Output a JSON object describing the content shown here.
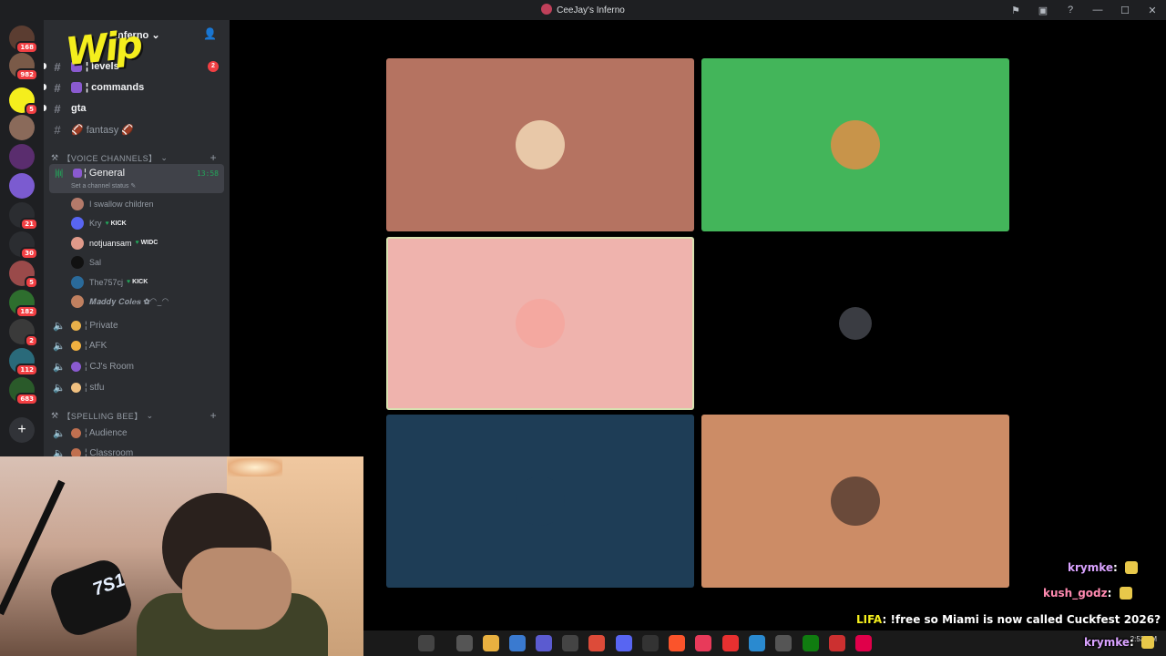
{
  "window": {
    "title": "CeeJay's Inferno"
  },
  "overlay_logo": "Wip",
  "rail": {
    "servers": [
      {
        "badge": "168",
        "color": "#5b3d31"
      },
      {
        "badge": "982",
        "color": "#7a5a48"
      },
      {
        "badge": "5",
        "color": "#f4ee1d"
      },
      {
        "badge": "",
        "color": "#8a6a5a"
      },
      {
        "badge": "",
        "color": "#5a2d6e"
      },
      {
        "badge": "",
        "color": "#7b5bd0"
      },
      {
        "badge": "21",
        "color": "#2b2d31"
      },
      {
        "badge": "30",
        "color": "#2b2d31"
      },
      {
        "badge": "5",
        "color": "#9a4a4a"
      },
      {
        "badge": "182",
        "color": "#2e6e2e"
      },
      {
        "badge": "2",
        "color": "#3a3a3a"
      },
      {
        "badge": "112",
        "color": "#2a6a7a"
      },
      {
        "badge": "683",
        "color": "#2a5a2a"
      }
    ],
    "add_server": "+"
  },
  "sidebar": {
    "server_name": "Inferno",
    "text_channels": [
      {
        "name": "¦ levels",
        "mention": "2",
        "bright": true
      },
      {
        "name": "¦ commands",
        "bright": true
      },
      {
        "name": "gta",
        "bright": true
      },
      {
        "name": "🏈 fantasy 🏈",
        "bright": false
      }
    ],
    "voice_category": "【VOICE CHANNELS】",
    "active_voice": {
      "name": "¦ General",
      "time": "13:58",
      "status": "Set a channel status ✎"
    },
    "members": [
      {
        "name": "I swallow children",
        "tag": "",
        "bright": false,
        "avatar": "#b47a6a"
      },
      {
        "name": "Kry",
        "tag": "KICK",
        "bright": false,
        "avatar": "#5865f2"
      },
      {
        "name": "notjuansam",
        "tag": "WIDC",
        "bright": true,
        "avatar": "#e09a8a"
      },
      {
        "name": "Sal",
        "tag": "",
        "bright": false,
        "avatar": "#111111"
      },
      {
        "name": "The757cj",
        "tag": "KICK",
        "bright": false,
        "avatar": "#2a6a9a"
      },
      {
        "name": "𝑴𝒂𝒅𝒅𝒚 𝑪𝒐𝒍𝒆𝒔 ✿◠‿◠",
        "tag": "",
        "bright": false,
        "avatar": "#c08060"
      }
    ],
    "voice_channels": [
      {
        "name": "¦ Private",
        "emoji": "#e8b04a"
      },
      {
        "name": "¦ AFK",
        "emoji": "#f0b040"
      },
      {
        "name": "¦ CJ's Room",
        "emoji": "#8a5ad0"
      },
      {
        "name": "¦ stfu",
        "emoji": "#f0c080"
      }
    ],
    "spelling_category": "【SPELLING BEE】",
    "spelling_channels": [
      {
        "name": "¦ Audience"
      },
      {
        "name": "¦ Classroom"
      }
    ]
  },
  "tiles": [
    {
      "bg": "#b57361",
      "avatar": "#e8c8a8",
      "speaking": false
    },
    {
      "bg": "#43b55a",
      "avatar": "#c8944a",
      "speaking": false
    },
    {
      "bg": "#efb3ad",
      "avatar": "#f4a8a0",
      "speaking": true
    },
    {
      "bg": "#000000",
      "avatar": "#2b2d31",
      "speaking": false
    },
    {
      "bg": "#1e3d56",
      "avatar": "#1e3d56",
      "speaking": false
    },
    {
      "bg": "#cc8c66",
      "avatar": "#6a4a3a",
      "speaking": false
    }
  ],
  "webcam": {
    "mic_text": "7S1"
  },
  "chat": [
    {
      "user": "krymke",
      "text": ""
    },
    {
      "user": "kush_godz",
      "text": ""
    },
    {
      "user": "LIFA",
      "text": "!free so Miami is now called Cuckfest 2026?"
    },
    {
      "user": "krymke",
      "text": ""
    }
  ],
  "tray": {
    "time": "2:53 AM"
  }
}
